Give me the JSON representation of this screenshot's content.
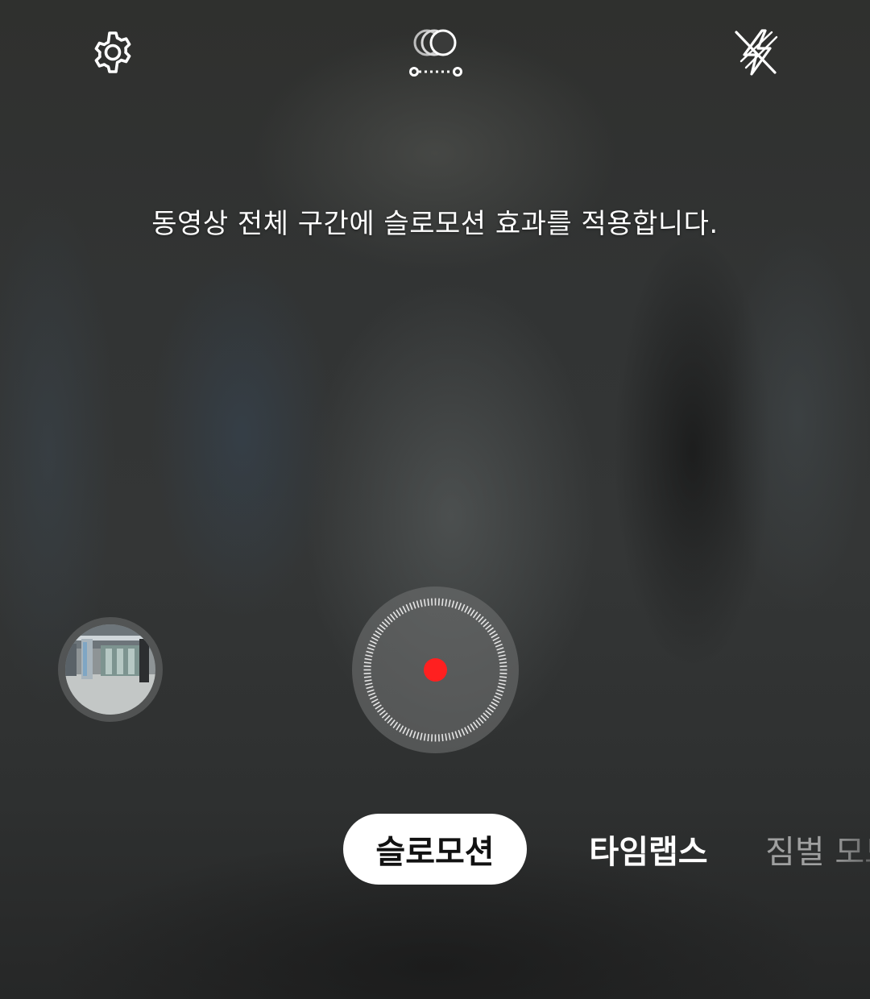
{
  "top_bar": {
    "settings_icon": "gear-icon",
    "effect_icon": "slow-motion-effect-icon",
    "flash_icon": "flash-off-icon"
  },
  "hint_text": "동영상 전체 구간에 슬로모션 효과를 적용합니다.",
  "gallery": {
    "thumbnail_icon": "last-capture-thumbnail"
  },
  "shutter": {
    "icon": "record-button",
    "record_color": "#ff2020"
  },
  "modes": [
    {
      "label": "슬로모션",
      "selected": true
    },
    {
      "label": "타임랩스",
      "selected": false
    },
    {
      "label": "짐벌 모드",
      "selected": false
    }
  ]
}
